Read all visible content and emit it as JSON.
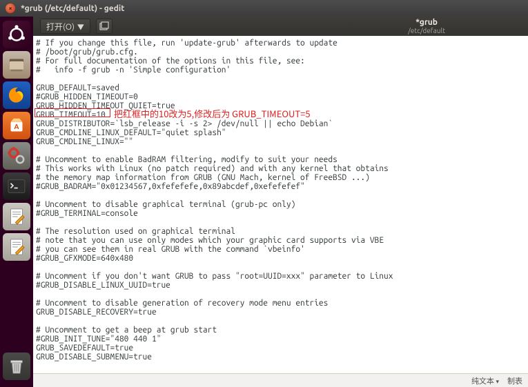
{
  "window": {
    "title": "*grub (/etc/default) - gedit"
  },
  "toolbar": {
    "open_label": "打开(O)",
    "doc_tab_title": "*grub",
    "doc_tab_path": "/etc/default"
  },
  "annotation": {
    "text": "把红框中的10改为5,修改后为 GRUB_TIMEOUT=5"
  },
  "status": {
    "encoding": "纯文本",
    "tab": "制表"
  },
  "file_lines": [
    "# If you change this file, run 'update-grub' afterwards to update",
    "# /boot/grub/grub.cfg.",
    "# For full documentation of the options in this file, see:",
    "#   info -f grub -n 'Simple configuration'",
    "",
    "GRUB_DEFAULT=saved",
    "#GRUB_HIDDEN_TIMEOUT=0",
    "GRUB_HIDDEN_TIMEOUT_QUIET=true",
    "GRUB_TIMEOUT=10",
    "GRUB_DISTRIBUTOR=`lsb_release -i -s 2> /dev/null || echo Debian`",
    "GRUB_CMDLINE_LINUX_DEFAULT=\"quiet splash\"",
    "GRUB_CMDLINE_LINUX=\"\"",
    "",
    "# Uncomment to enable BadRAM filtering, modify to suit your needs",
    "# This works with Linux (no patch required) and with any kernel that obtains",
    "# the memory map information from GRUB (GNU Mach, kernel of FreeBSD ...)",
    "#GRUB_BADRAM=\"0x01234567,0xfefefefe,0x89abcdef,0xefefefef\"",
    "",
    "# Uncomment to disable graphical terminal (grub-pc only)",
    "#GRUB_TERMINAL=console",
    "",
    "# The resolution used on graphical terminal",
    "# note that you can use only modes which your graphic card supports via VBE",
    "# you can see them in real GRUB with the command `vbeinfo'",
    "#GRUB_GFXMODE=640x480",
    "",
    "# Uncomment if you don't want GRUB to pass \"root=UUID=xxx\" parameter to Linux",
    "#GRUB_DISABLE_LINUX_UUID=true",
    "",
    "# Uncomment to disable generation of recovery mode menu entries",
    "GRUB_DISABLE_RECOVERY=true",
    "",
    "# Uncomment to get a beep at grub start",
    "#GRUB_INIT_TUNE=\"480 440 1\"",
    "GRUB_SAVEDEFAULT=true",
    "GRUB_DISABLE_SUBMENU=true"
  ]
}
